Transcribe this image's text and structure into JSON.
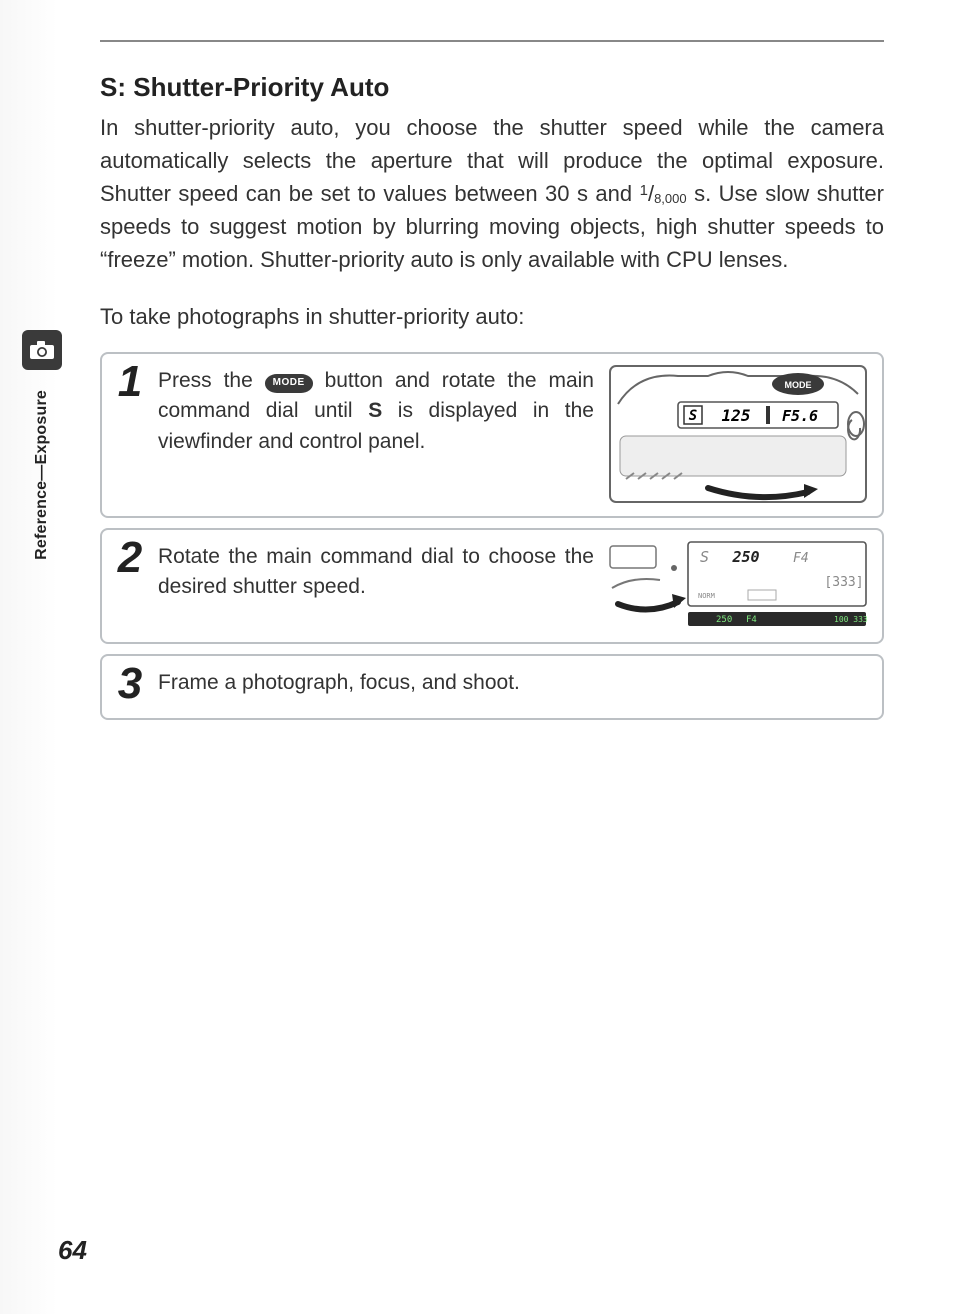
{
  "page_number": "64",
  "side_label": "Reference—Exposure",
  "heading": "S: Shutter-Priority Auto",
  "intro_parts": {
    "a": "In shutter-priority auto, you choose the shutter speed while the camera automatically selects the aperture that will produce the optimal exposure.  Shutter speed can be set to values between 30 s and ",
    "frac_num": "1",
    "frac_den": "8,000",
    "b": " s.  Use slow shutter speeds to suggest motion by blurring moving objects, high shutter speeds to “freeze” motion.  Shutter-priority auto is only available with CPU lenses."
  },
  "lead": "To take photographs in shutter-priority auto:",
  "steps": [
    {
      "num": "1",
      "text_a": "Press the ",
      "mode_label": "MODE",
      "text_b": " button and rotate the main command dial until ",
      "bold": "S",
      "text_c": " is displayed in the viewfinder and control panel."
    },
    {
      "num": "2",
      "text_a": "Rotate the main command dial to choose the desired shutter speed.",
      "mode_label": "",
      "text_b": "",
      "bold": "",
      "text_c": ""
    },
    {
      "num": "3",
      "text_a": "Frame a photograph, focus, and shoot.",
      "mode_label": "",
      "text_b": "",
      "bold": "",
      "text_c": ""
    }
  ],
  "illus1": {
    "panel_s": "S",
    "panel_shutter": "125",
    "panel_aperture": "F5.6",
    "mode_btn": "MODE"
  },
  "illus2": {
    "lcd_mode": "S",
    "lcd_shutter": "250",
    "lcd_aperture": "F4",
    "lcd_count": "333",
    "vf_shutter": "250",
    "vf_aperture": "F4",
    "vf_right": "100 333",
    "norm": "NORM"
  }
}
